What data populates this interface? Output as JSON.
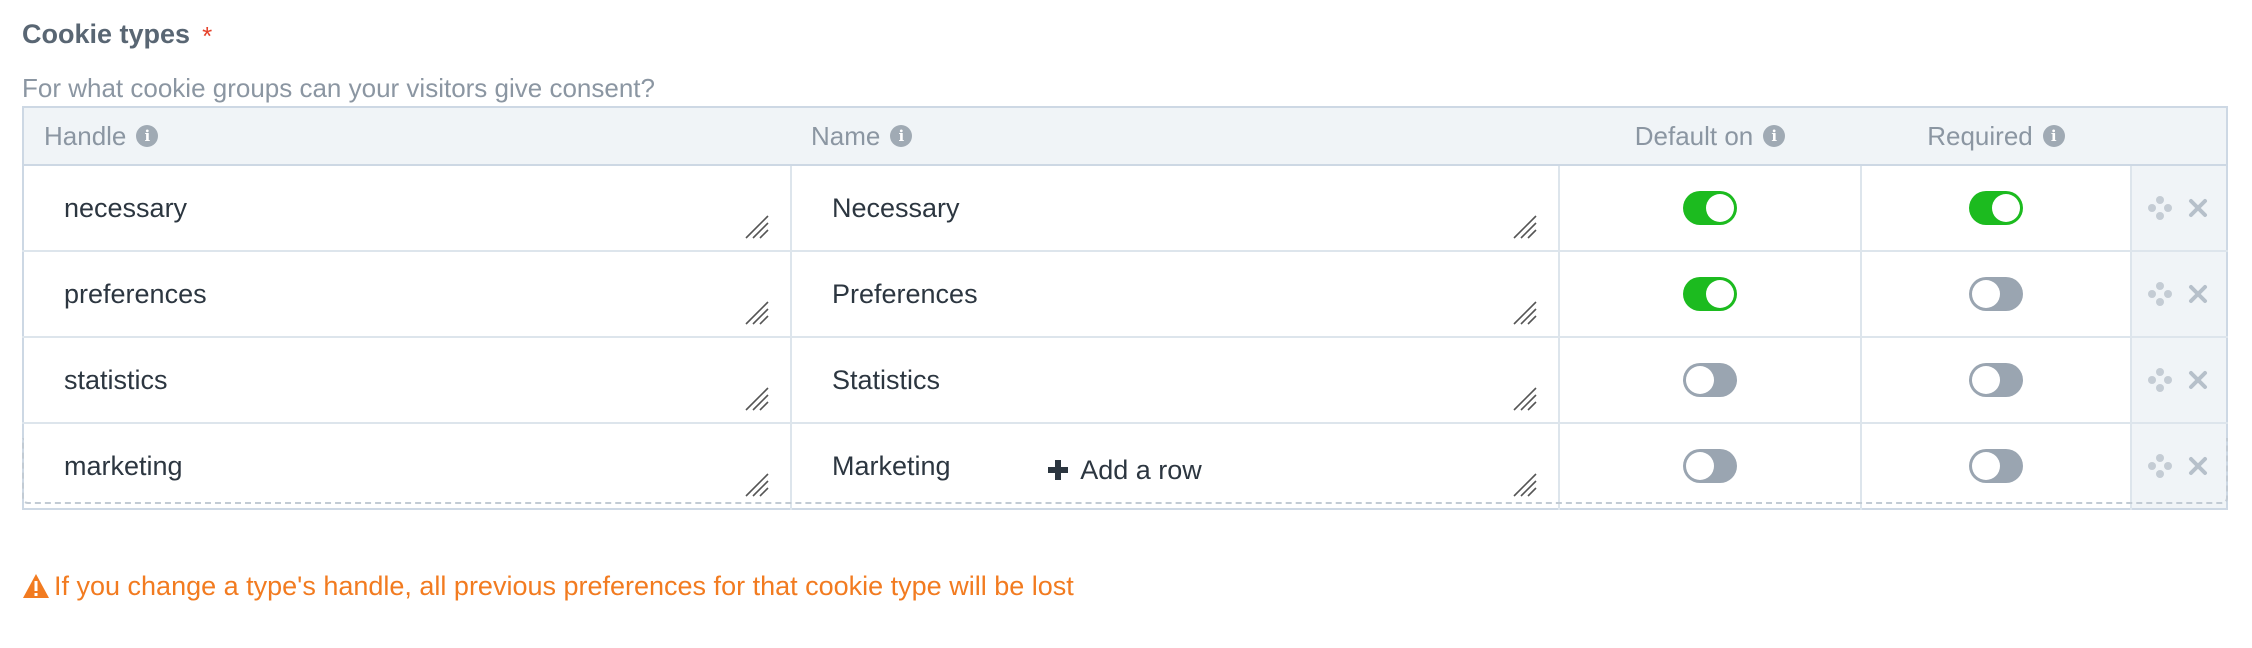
{
  "field": {
    "label": "Cookie types",
    "required_mark": "*",
    "instructions": "For what cookie groups can your visitors give consent?"
  },
  "table": {
    "columns": {
      "handle": "Handle",
      "name": "Name",
      "default_on": "Default on",
      "required": "Required"
    },
    "info_glyph": "i",
    "rows": [
      {
        "handle": "necessary",
        "name": "Necessary",
        "default_on": true,
        "required": true
      },
      {
        "handle": "preferences",
        "name": "Preferences",
        "default_on": true,
        "required": false
      },
      {
        "handle": "statistics",
        "name": "Statistics",
        "default_on": false,
        "required": false
      },
      {
        "handle": "marketing",
        "name": "Marketing",
        "default_on": false,
        "required": false
      }
    ]
  },
  "add_row": {
    "label": "Add a row"
  },
  "warning": {
    "text": "If you change a type's handle, all previous preferences for that cookie type will be lost",
    "icon": "warning-triangle-icon"
  },
  "colors": {
    "switch_on": "#1cbb1f",
    "switch_off": "#9aa5b1",
    "warning": "#f27b20",
    "required_mark": "#e5422b"
  }
}
